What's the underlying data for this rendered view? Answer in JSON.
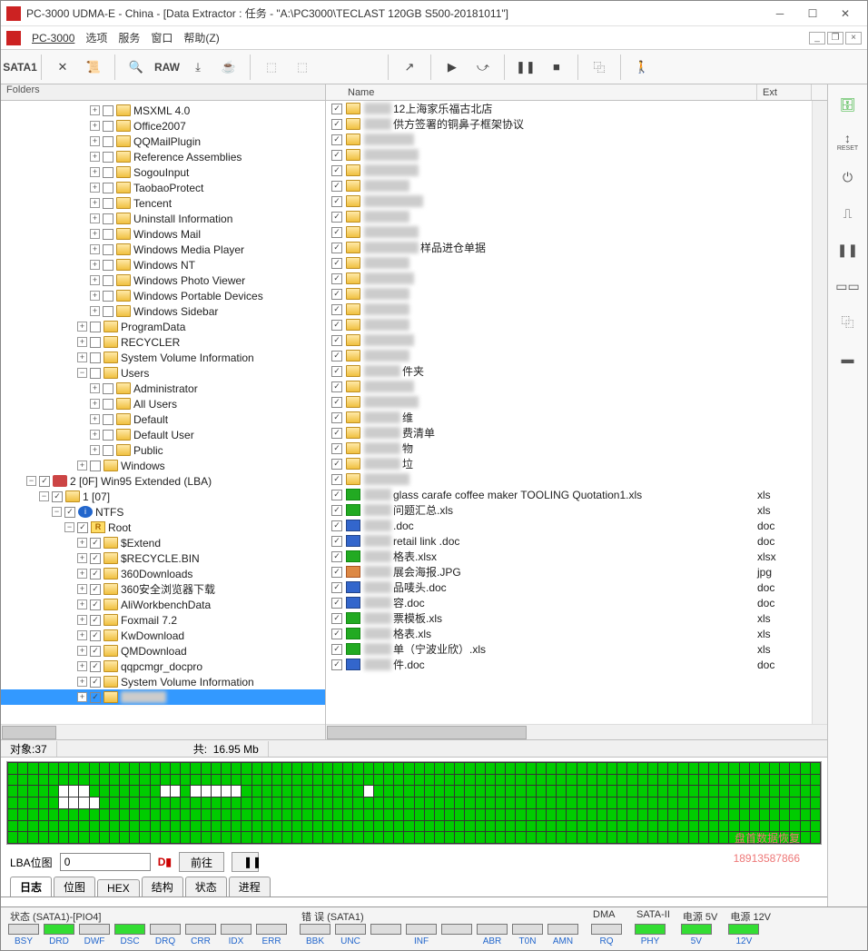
{
  "window": {
    "title": "PC-3000 UDMA-E - China - [Data Extractor : 任务 - \"A:\\PC3000\\TECLAST 120GB S500-20181011\"]"
  },
  "menu": {
    "app": "PC-3000",
    "items": [
      "选项",
      "服务",
      "窗口",
      "帮助(Z)"
    ]
  },
  "toolbar": {
    "sata_label": "SATA1",
    "raw_label": "RAW"
  },
  "left_pane": {
    "header": "Folders",
    "tree": [
      {
        "indent": 7,
        "toggle": "+",
        "check": false,
        "icon": "folder",
        "label": "MSXML 4.0"
      },
      {
        "indent": 7,
        "toggle": "+",
        "check": false,
        "icon": "folder",
        "label": "Office2007"
      },
      {
        "indent": 7,
        "toggle": "+",
        "check": false,
        "icon": "folder",
        "label": "QQMailPlugin"
      },
      {
        "indent": 7,
        "toggle": "+",
        "check": false,
        "icon": "folder",
        "label": "Reference Assemblies"
      },
      {
        "indent": 7,
        "toggle": "+",
        "check": false,
        "icon": "folder",
        "label": "SogouInput"
      },
      {
        "indent": 7,
        "toggle": "+",
        "check": false,
        "icon": "folder",
        "label": "TaobaoProtect"
      },
      {
        "indent": 7,
        "toggle": "+",
        "check": false,
        "icon": "folder",
        "label": "Tencent"
      },
      {
        "indent": 7,
        "toggle": "+",
        "check": false,
        "icon": "folder",
        "label": "Uninstall Information"
      },
      {
        "indent": 7,
        "toggle": "+",
        "check": false,
        "icon": "folder",
        "label": "Windows Mail"
      },
      {
        "indent": 7,
        "toggle": "+",
        "check": false,
        "icon": "folder",
        "label": "Windows Media Player"
      },
      {
        "indent": 7,
        "toggle": "+",
        "check": false,
        "icon": "folder",
        "label": "Windows NT"
      },
      {
        "indent": 7,
        "toggle": "+",
        "check": false,
        "icon": "folder",
        "label": "Windows Photo Viewer"
      },
      {
        "indent": 7,
        "toggle": "+",
        "check": false,
        "icon": "folder",
        "label": "Windows Portable Devices"
      },
      {
        "indent": 7,
        "toggle": "+",
        "check": false,
        "icon": "folder",
        "label": "Windows Sidebar"
      },
      {
        "indent": 6,
        "toggle": "+",
        "check": false,
        "icon": "folder",
        "label": "ProgramData"
      },
      {
        "indent": 6,
        "toggle": "+",
        "check": false,
        "icon": "folder",
        "label": "RECYCLER"
      },
      {
        "indent": 6,
        "toggle": "+",
        "check": false,
        "icon": "folder",
        "label": "System Volume Information"
      },
      {
        "indent": 6,
        "toggle": "-",
        "check": false,
        "icon": "folder",
        "label": "Users"
      },
      {
        "indent": 7,
        "toggle": "+",
        "check": false,
        "icon": "folder",
        "label": "Administrator"
      },
      {
        "indent": 7,
        "toggle": "+",
        "check": false,
        "icon": "folder",
        "label": "All Users"
      },
      {
        "indent": 7,
        "toggle": "+",
        "check": false,
        "icon": "folder",
        "label": "Default"
      },
      {
        "indent": 7,
        "toggle": "+",
        "check": false,
        "icon": "folder",
        "label": "Default User"
      },
      {
        "indent": 7,
        "toggle": "+",
        "check": false,
        "icon": "folder",
        "label": "Public"
      },
      {
        "indent": 6,
        "toggle": "+",
        "check": false,
        "icon": "folder",
        "label": "Windows"
      },
      {
        "indent": 2,
        "toggle": "-",
        "check": true,
        "icon": "disk",
        "label": "2 [0F] Win95 Extended  (LBA)"
      },
      {
        "indent": 3,
        "toggle": "-",
        "check": true,
        "icon": "folder",
        "label": "1 [07]"
      },
      {
        "indent": 4,
        "toggle": "-",
        "check": true,
        "icon": "ntfs",
        "label": "NTFS"
      },
      {
        "indent": 5,
        "toggle": "-",
        "check": true,
        "icon": "root",
        "label": "Root"
      },
      {
        "indent": 6,
        "toggle": "+",
        "check": true,
        "icon": "folder",
        "label": "$Extend"
      },
      {
        "indent": 6,
        "toggle": "+",
        "check": true,
        "icon": "folder",
        "label": "$RECYCLE.BIN"
      },
      {
        "indent": 6,
        "toggle": "+",
        "check": true,
        "icon": "folder",
        "label": "360Downloads"
      },
      {
        "indent": 6,
        "toggle": "+",
        "check": true,
        "icon": "folder",
        "label": "360安全浏览器下载"
      },
      {
        "indent": 6,
        "toggle": "+",
        "check": true,
        "icon": "folder",
        "label": "AliWorkbenchData"
      },
      {
        "indent": 6,
        "toggle": "+",
        "check": true,
        "icon": "folder",
        "label": "Foxmail 7.2"
      },
      {
        "indent": 6,
        "toggle": "+",
        "check": true,
        "icon": "folder",
        "label": "KwDownload"
      },
      {
        "indent": 6,
        "toggle": "+",
        "check": true,
        "icon": "folder",
        "label": "QMDownload"
      },
      {
        "indent": 6,
        "toggle": "+",
        "check": true,
        "icon": "folder",
        "label": "qqpcmgr_docpro"
      },
      {
        "indent": 6,
        "toggle": "+",
        "check": true,
        "icon": "folder",
        "label": "System Volume Information"
      },
      {
        "indent": 6,
        "toggle": "+",
        "check": true,
        "icon": "folder",
        "label": "",
        "selected": true,
        "blurred": true
      }
    ]
  },
  "right_pane": {
    "columns": {
      "name": "Name",
      "ext": "Ext"
    },
    "rows": [
      {
        "check": true,
        "icon": "folder",
        "blur": 30,
        "name": "12上海家乐福古北店",
        "ext": ""
      },
      {
        "check": true,
        "icon": "folder",
        "blur": 30,
        "name": "供方签署的铜鼻子框架协议",
        "ext": ""
      },
      {
        "check": true,
        "icon": "folder",
        "blur": 55,
        "name": "",
        "ext": ""
      },
      {
        "check": true,
        "icon": "folder",
        "blur": 60,
        "name": "",
        "ext": ""
      },
      {
        "check": true,
        "icon": "folder",
        "blur": 60,
        "name": "",
        "ext": ""
      },
      {
        "check": true,
        "icon": "folder",
        "blur": 50,
        "name": "",
        "ext": ""
      },
      {
        "check": true,
        "icon": "folder",
        "blur": 65,
        "name": "",
        "ext": ""
      },
      {
        "check": true,
        "icon": "folder",
        "blur": 50,
        "name": "",
        "ext": ""
      },
      {
        "check": true,
        "icon": "folder",
        "blur": 60,
        "name": "",
        "ext": ""
      },
      {
        "check": true,
        "icon": "folder",
        "blur": 60,
        "name": "样品进仓单据",
        "ext": ""
      },
      {
        "check": true,
        "icon": "folder",
        "blur": 50,
        "name": "",
        "ext": ""
      },
      {
        "check": true,
        "icon": "folder",
        "blur": 55,
        "name": "",
        "ext": ""
      },
      {
        "check": true,
        "icon": "folder",
        "blur": 50,
        "name": "",
        "ext": ""
      },
      {
        "check": true,
        "icon": "folder",
        "blur": 50,
        "name": "",
        "ext": ""
      },
      {
        "check": true,
        "icon": "folder",
        "blur": 50,
        "name": "",
        "ext": ""
      },
      {
        "check": true,
        "icon": "folder",
        "blur": 55,
        "name": "",
        "ext": ""
      },
      {
        "check": true,
        "icon": "folder",
        "blur": 50,
        "name": "",
        "ext": ""
      },
      {
        "check": true,
        "icon": "folder",
        "blur": 40,
        "name": "件夹",
        "ext": ""
      },
      {
        "check": true,
        "icon": "folder",
        "blur": 55,
        "name": "",
        "ext": ""
      },
      {
        "check": true,
        "icon": "folder",
        "blur": 60,
        "name": "",
        "ext": ""
      },
      {
        "check": true,
        "icon": "folder",
        "blur": 40,
        "name": "维",
        "ext": ""
      },
      {
        "check": true,
        "icon": "folder",
        "blur": 40,
        "name": "费清单",
        "ext": ""
      },
      {
        "check": true,
        "icon": "folder",
        "blur": 40,
        "name": "物",
        "ext": ""
      },
      {
        "check": true,
        "icon": "folder",
        "blur": 40,
        "name": "垃",
        "ext": ""
      },
      {
        "check": true,
        "icon": "folder",
        "blur": 50,
        "name": "",
        "ext": ""
      },
      {
        "check": true,
        "icon": "xls",
        "blur": 30,
        "name": "glass carafe coffee maker TOOLING Quotation1.xls",
        "ext": "xls"
      },
      {
        "check": true,
        "icon": "xls",
        "blur": 30,
        "name": "问题汇总.xls",
        "ext": "xls"
      },
      {
        "check": true,
        "icon": "doc",
        "blur": 30,
        "name": ".doc",
        "ext": "doc"
      },
      {
        "check": true,
        "icon": "doc",
        "blur": 30,
        "name": " retail link .doc",
        "ext": "doc"
      },
      {
        "check": true,
        "icon": "xls",
        "blur": 30,
        "name": "格表.xlsx",
        "ext": "xlsx"
      },
      {
        "check": true,
        "icon": "jpg",
        "blur": 30,
        "name": "展会海报.JPG",
        "ext": "jpg"
      },
      {
        "check": true,
        "icon": "doc",
        "blur": 30,
        "name": "品唛头.doc",
        "ext": "doc"
      },
      {
        "check": true,
        "icon": "doc",
        "blur": 30,
        "name": "容.doc",
        "ext": "doc"
      },
      {
        "check": true,
        "icon": "xls",
        "blur": 30,
        "name": "票模板.xls",
        "ext": "xls"
      },
      {
        "check": true,
        "icon": "xls",
        "blur": 30,
        "name": "格表.xls",
        "ext": "xls"
      },
      {
        "check": true,
        "icon": "xls",
        "blur": 30,
        "name": "单（宁波业欣）.xls",
        "ext": "xls"
      },
      {
        "check": true,
        "icon": "doc",
        "blur": 30,
        "name": "件.doc",
        "ext": "doc"
      }
    ]
  },
  "status": {
    "objects_label": "对象:",
    "objects_count": "37",
    "total_label": "共:",
    "total_size": "16.95 Mb"
  },
  "lba": {
    "label": "LBA位图",
    "value": "0",
    "goto": "前往"
  },
  "watermark": {
    "line1": "盘首数据恢复",
    "line2": "18913587866"
  },
  "tabs": [
    "日志",
    "位图",
    "HEX",
    "结构",
    "状态",
    "进程"
  ],
  "tabs_active": 0,
  "hw": {
    "groups": [
      {
        "label": "状态 (SATA1)-[PIO4]",
        "leds": [
          {
            "lbl": "BSY",
            "on": false
          },
          {
            "lbl": "DRD",
            "on": true
          },
          {
            "lbl": "DWF",
            "on": false
          },
          {
            "lbl": "DSC",
            "on": true
          },
          {
            "lbl": "DRQ",
            "on": false
          },
          {
            "lbl": "CRR",
            "on": false
          },
          {
            "lbl": "IDX",
            "on": false
          },
          {
            "lbl": "ERR",
            "on": false
          }
        ]
      },
      {
        "label": "错 误 (SATA1)",
        "leds": [
          {
            "lbl": "BBK",
            "on": false
          },
          {
            "lbl": "UNC",
            "on": false
          },
          {
            "lbl": "",
            "on": false
          },
          {
            "lbl": "INF",
            "on": false
          },
          {
            "lbl": "",
            "on": false
          },
          {
            "lbl": "ABR",
            "on": false
          },
          {
            "lbl": "T0N",
            "on": false
          },
          {
            "lbl": "AMN",
            "on": false
          }
        ]
      },
      {
        "label": "DMA",
        "leds": [
          {
            "lbl": "RQ",
            "on": false
          }
        ]
      },
      {
        "label": "SATA-II",
        "leds": [
          {
            "lbl": "PHY",
            "on": true
          }
        ]
      },
      {
        "label": "电源 5V",
        "leds": [
          {
            "lbl": "5V",
            "on": true
          }
        ]
      },
      {
        "label": "电源 12V",
        "leds": [
          {
            "lbl": "12V",
            "on": true
          }
        ]
      }
    ]
  },
  "vtoolbar": {
    "reset": "RESET"
  }
}
